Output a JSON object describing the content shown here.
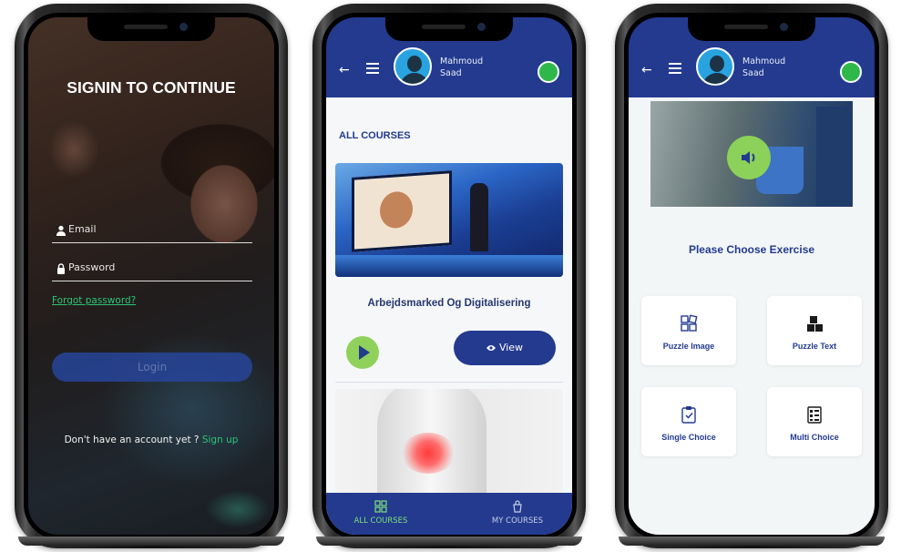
{
  "signin": {
    "title": "SIGNIN TO CONTINUE",
    "email_placeholder": "Email",
    "password_placeholder": "Password",
    "forgot_label": "Forgot password?",
    "login_label": "Login",
    "signup_prompt": "Don't have an account yet ?",
    "signup_link": "Sign up"
  },
  "header": {
    "user_name_line1": "Mahmoud",
    "user_name_line2": "Saad"
  },
  "courses": {
    "section_title": "ALL COURSES",
    "items": [
      {
        "title": "Arbejdsmarked Og Digitalisering",
        "view_label": "View"
      }
    ],
    "tabs": [
      {
        "label": "ALL COURSES",
        "icon": "grid-icon",
        "active": true
      },
      {
        "label": "MY COURSES",
        "icon": "bag-icon",
        "active": false
      }
    ]
  },
  "exercise": {
    "prompt": "Please Choose Exercise",
    "options": [
      {
        "label": "Puzzle Image",
        "icon": "puzzle-image-icon"
      },
      {
        "label": "Puzzle Text",
        "icon": "puzzle-text-icon"
      },
      {
        "label": "Single Choice",
        "icon": "clipboard-check-icon"
      },
      {
        "label": "Multi Choice",
        "icon": "checklist-icon"
      }
    ]
  },
  "colors": {
    "primary": "#233a8f",
    "accent_green": "#8bd15a",
    "link_green": "#2cc476",
    "background": "#f6f7f9"
  }
}
